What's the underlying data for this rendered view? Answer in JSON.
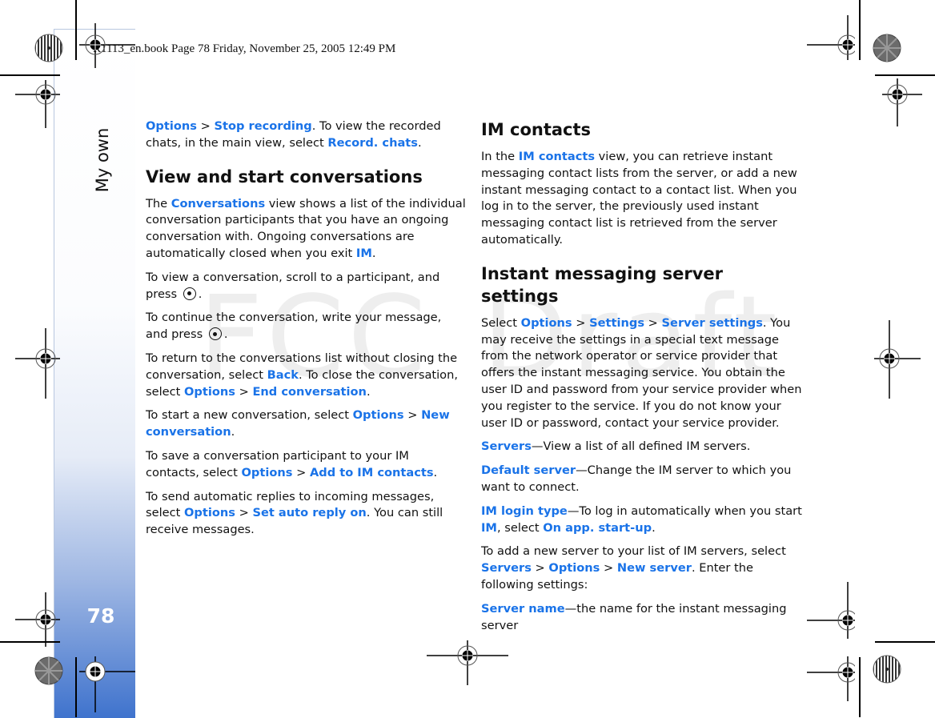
{
  "header": {
    "print_info": "R1113_en.book  Page 78  Friday, November 25, 2005  12:49 PM"
  },
  "sidebar": {
    "section_label": "My own",
    "page_number": "78"
  },
  "watermark": {
    "left": "FCC",
    "right": "Draft"
  },
  "left_column": {
    "intro": {
      "l1": "Options",
      "sep1": " > ",
      "l2": "Stop recording",
      "t1": ". To view the recorded chats, in the main view, select ",
      "l3": "Record. chats",
      "t2": "."
    },
    "heading": "View and start conversations",
    "p1": {
      "t1": "The ",
      "l1": "Conversations",
      "t2": " view shows a list of the individual conversation participants that you have an ongoing conversation with. Ongoing conversations are automatically closed when you exit ",
      "l2": "IM",
      "t3": "."
    },
    "p2": {
      "t1": "To view a conversation, scroll to a participant, and press",
      "t2": "."
    },
    "p3": {
      "t1": "To continue the conversation, write your message, and press",
      "t2": "."
    },
    "p4": {
      "t1": "To return to the conversations list without closing the conversation, select ",
      "l1": "Back",
      "t2": ". To close the conversation, select ",
      "l2": "Options",
      "sep": " > ",
      "l3": "End conversation",
      "t3": "."
    },
    "p5": {
      "t1": "To start a new conversation, select ",
      "l1": "Options",
      "sep": " > ",
      "l2": "New conversation",
      "t2": "."
    },
    "p6": {
      "t1": "To save a conversation participant to your IM contacts, select ",
      "l1": "Options",
      "sep": " > ",
      "l2": "Add to IM contacts",
      "t2": "."
    },
    "p7": {
      "t1": "To send automatic replies to incoming messages, select ",
      "l1": "Options",
      "sep": " > ",
      "l2": "Set auto reply on",
      "t2": ". You can still receive messages."
    }
  },
  "right_column": {
    "heading1": "IM contacts",
    "p1": {
      "t1": "In the ",
      "l1": "IM contacts",
      "t2": " view, you can retrieve instant messaging contact lists from the server, or add a new instant messaging contact to a contact list. When you log in to the server, the previously used instant messaging contact list is retrieved from the server automatically."
    },
    "heading2": "Instant messaging server settings",
    "p2": {
      "t1": "Select ",
      "l1": "Options",
      "sep1": " > ",
      "l2": "Settings",
      "sep2": " > ",
      "l3": "Server settings",
      "t2": ". You may receive the settings in a special text message from the network operator or service provider that offers the instant messaging service. You obtain the user ID and password from your service provider when you register to the service. If you do not know your user ID or password, contact your service provider."
    },
    "p3": {
      "l1": "Servers",
      "t1": "—View a list of all defined IM servers."
    },
    "p4": {
      "l1": "Default server",
      "t1": "—Change the IM server to which you want to connect."
    },
    "p5": {
      "l1": "IM login type",
      "t1": "—To log in automatically when you start ",
      "l2": "IM",
      "t2": ", select ",
      "l3": "On app. start-up",
      "t3": "."
    },
    "p6": {
      "t1": "To add a new server to your list of IM servers, select ",
      "l1": "Servers",
      "sep1": " > ",
      "l2": "Options",
      "sep2": " > ",
      "l3": "New server",
      "t2": ". Enter the following settings:"
    },
    "p7": {
      "l1": "Server name",
      "t1": "—the name for the instant messaging server"
    }
  },
  "icons": {
    "select_key": "joystick-select-key-icon",
    "registration": "registration-mark-icon",
    "color_bar": "color-registration-target-icon"
  }
}
